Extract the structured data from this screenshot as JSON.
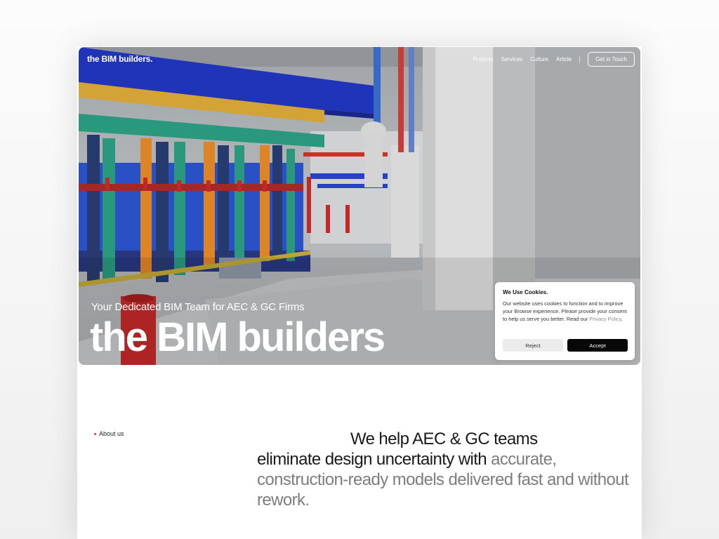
{
  "header": {
    "brand": "the BIM builders.",
    "nav": [
      "Projects",
      "Services",
      "Culture",
      "Article"
    ],
    "cta": "Get in Touch"
  },
  "hero": {
    "subtitle": "Your Dedicated BIM Team for AEC & GC Firms",
    "title": "the BIM builders"
  },
  "cookie": {
    "title": "We Use Cookies.",
    "body": "Our website uses cookies to function and to improve your Browse experience. Please provide your consent to help us serve you better. Read our ",
    "link": "Privacy Policy",
    "after_link": ".",
    "reject": "Reject",
    "accept": "Accept"
  },
  "about": {
    "label": "About us",
    "line1": "We help AEC & GC teams",
    "line2_dark": "eliminate design uncertainty with ",
    "line2_muted": "accurate,",
    "line3_muted": "construction-ready models delivered fast and without rework."
  },
  "colors": {
    "accent_dot": "#e23a2a",
    "accept_button": "#080808",
    "muted_text": "#7d7d7d"
  }
}
